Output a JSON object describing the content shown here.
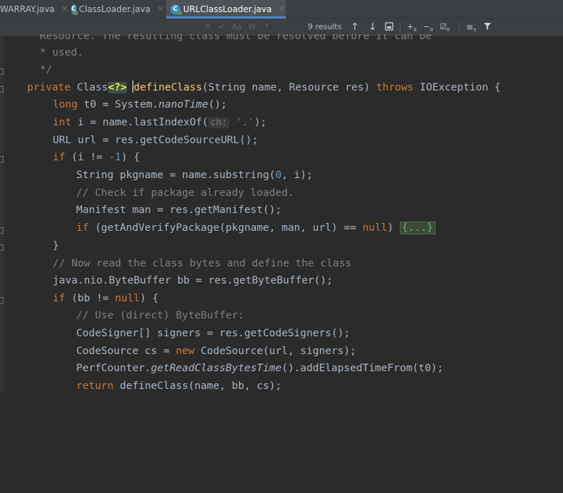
{
  "tabs": [
    {
      "label": "WARRAY.java",
      "active": false
    },
    {
      "label": "ClassLoader.java",
      "active": false
    },
    {
      "label": "URLClassLoader.java",
      "active": true
    }
  ],
  "find_bar": {
    "results": "9 results",
    "match_case_label": "Aa",
    "words_label": "W",
    "regex_label": ".*"
  },
  "code": {
    "l0": " Resource. The resulting class must be resolved before it can be",
    "l1": " * used.",
    "l2": " */",
    "l3_kw": "private",
    "l3_type": "Class",
    "l3_generic": "<?>",
    "l3_name": "defineClass",
    "l3_params": "(String name, Resource res)",
    "l3_throws": "throws",
    "l3_exc": "IOException {",
    "l4_kw": "long",
    "l4_a": " t0 = System.",
    "l4_m": "nanoTime",
    "l4_b": "();",
    "l5_kw": "int",
    "l5_a": " i = name.lastIndexOf(",
    "l5_hint": "ch:",
    "l5_str": "'.'",
    "l5_b": ");",
    "l6": "URL url = res.getCodeSourceURL();",
    "l7_kw": "if",
    "l7_a": " (i != ",
    "l7_num": "-1",
    "l7_b": ") {",
    "l8_a": "String pkgname = name.substring(",
    "l8_num": "0",
    "l8_b": ", i);",
    "l9": "// Check if package already loaded.",
    "l10": "Manifest man = res.getManifest();",
    "l11_kw": "if",
    "l11_a": " (getAndVerifyPackage(pkgname, man, url) == ",
    "l11_null": "null",
    "l11_b": ") ",
    "l11_fold": "{...}",
    "l12": "}",
    "l13": "// Now read the class bytes and define the class",
    "l14": "java.nio.ByteBuffer bb = res.getByteBuffer();",
    "l15_kw": "if",
    "l15_a": " (bb != ",
    "l15_null": "null",
    "l15_b": ") {",
    "l16": "// Use (direct) ByteBuffer:",
    "l17": "CodeSigner[] signers = res.getCodeSigners();",
    "l18_a": "CodeSource cs = ",
    "l18_new": "new",
    "l18_b": " CodeSource(url, signers);",
    "l19_a": "PerfCounter.",
    "l19_m": "getReadClassBytesTime",
    "l19_b": "().addElapsedTimeFrom(t0);",
    "l20_kw": "return",
    "l20_a": " defineClass(name, bb, cs);"
  },
  "colors": {
    "background": "#2b2b2b",
    "keyword": "#cc7832",
    "comment": "#808080",
    "number": "#6897bb",
    "string": "#6a8759",
    "method_decl": "#ffc66d",
    "text": "#a9b7c6"
  }
}
